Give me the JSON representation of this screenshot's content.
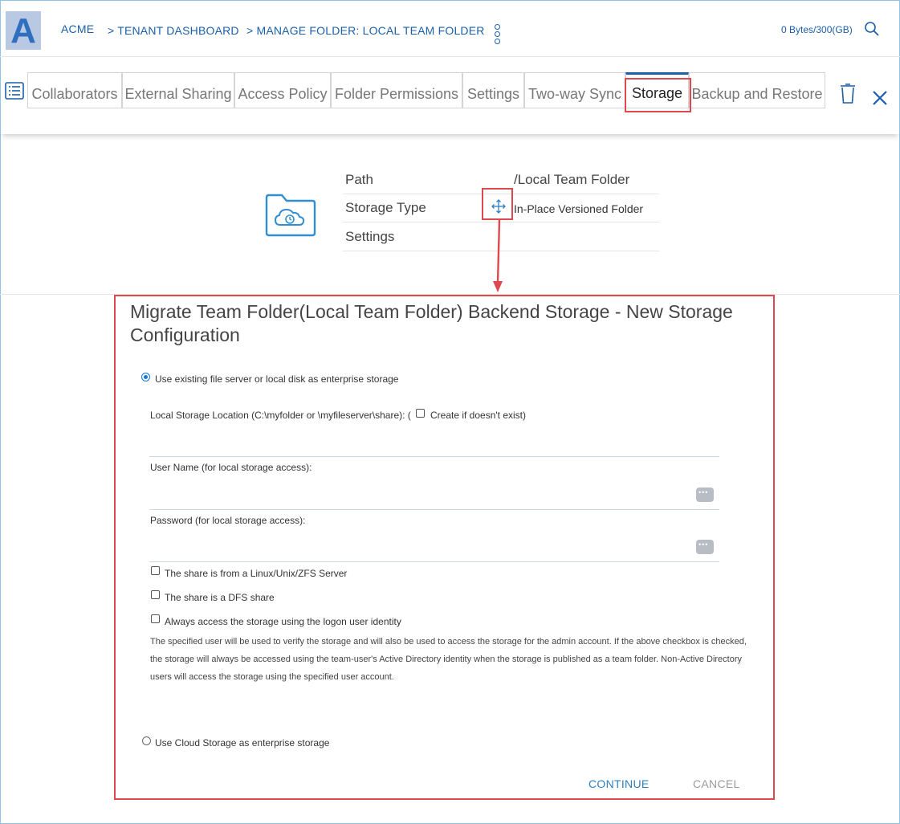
{
  "header": {
    "logo_letter": "A",
    "breadcrumb": [
      "ACME",
      "> TENANT DASHBOARD",
      "> MANAGE FOLDER: LOCAL TEAM FOLDER"
    ],
    "usage": "0 Bytes/300(GB)"
  },
  "tabs": [
    {
      "label": "Collaborators"
    },
    {
      "label": "External Sharing"
    },
    {
      "label": "Access Policy"
    },
    {
      "label": "Folder Permissions"
    },
    {
      "label": "Settings"
    },
    {
      "label": "Two-way Sync"
    },
    {
      "label": "Storage",
      "active": true
    },
    {
      "label": "Backup and Restore"
    }
  ],
  "info": {
    "path_label": "Path",
    "path_value": "/Local Team Folder",
    "storage_type_label": "Storage Type",
    "storage_type_value": "In-Place Versioned Folder",
    "settings_label": "Settings"
  },
  "dialog": {
    "title": "Migrate Team Folder(Local Team Folder) Backend Storage - New Storage Configuration",
    "option_local": "Use existing file server or local disk as enterprise storage",
    "local_location_label": "Local Storage Location (C:\\myfolder or \\myfileserver\\share): (",
    "create_if_missing": "Create if doesn't exist)",
    "username_label": "User Name (for local storage access):",
    "password_label": "Password (for local storage access):",
    "check_linux": "The share is from a Linux/Unix/ZFS Server",
    "check_dfs": "The share is a DFS share",
    "check_logon": "Always access the storage using the logon user identity",
    "note": "The specified user will be used to verify the storage and will also be used to access the storage for the admin account. If the above checkbox is checked, the storage will always be accessed using the team-user's Active Directory identity when the storage is published as a team folder. Non-Active Directory users will access the storage using the specified user account.",
    "option_cloud": "Use Cloud Storage as enterprise storage",
    "continue_label": "CONTINUE",
    "cancel_label": "CANCEL",
    "local_option_selected": true
  },
  "colors": {
    "accent": "#1b5fa8",
    "highlight": "#e0484f",
    "link": "#2f7fc1"
  }
}
